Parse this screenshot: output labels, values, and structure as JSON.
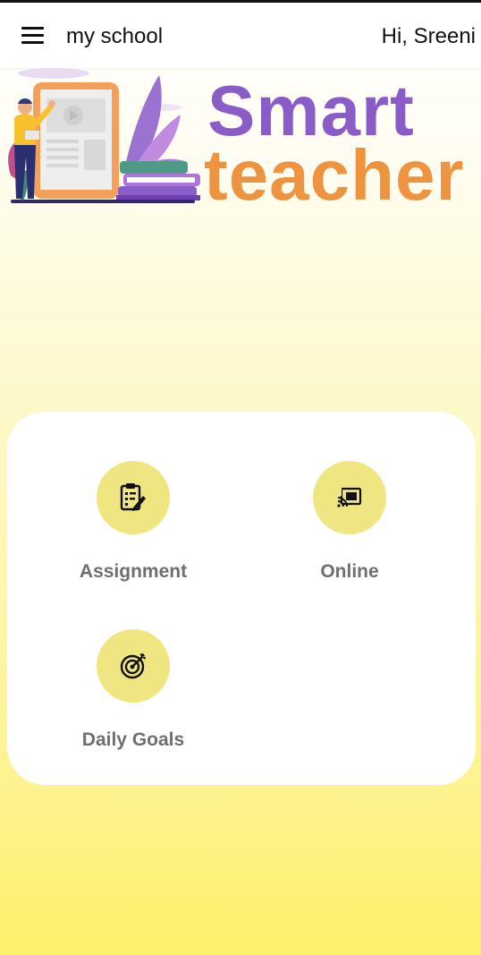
{
  "header": {
    "menu_icon": "hamburger-menu-icon",
    "title": "my school",
    "greeting": "Hi, Sreeni"
  },
  "banner": {
    "brand_line1": "Smart",
    "brand_line2": "teacher",
    "colors": {
      "smart": "#8a5cc8",
      "teacher": "#ee9440"
    }
  },
  "tiles": [
    {
      "label": "Assignment",
      "icon": "clipboard-pencil-icon"
    },
    {
      "label": "Online",
      "icon": "cast-icon"
    },
    {
      "label": "Daily Goals",
      "icon": "target-icon"
    }
  ],
  "theme": {
    "tile_circle": "#efe682",
    "tile_label": "#6f6f6f",
    "background_bottom": "#fdf06a"
  }
}
